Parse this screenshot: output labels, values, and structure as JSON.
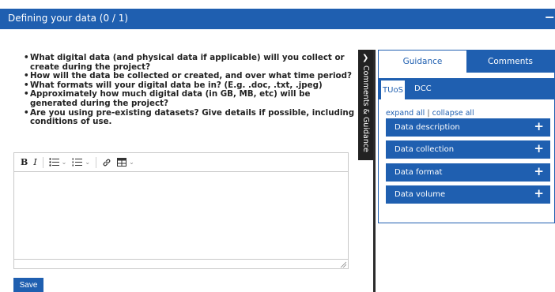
{
  "header": {
    "title": "Defining your data (0 / 1)",
    "toggle": "−"
  },
  "questions": [
    "What digital data (and physical data if applicable) will you collect or create during the project?",
    "How will the data be collected or created, and over what time period?",
    "What formats will your digital data be in? (E.g. .doc, .txt, .jpeg)",
    "Approximately how much digital data (in GB, MB, etc) will be generated during the project?",
    "Are you using pre-existing datasets? Give details if possible, including conditions of use."
  ],
  "editor": {
    "toolbar": {
      "bold": "B",
      "italic": "I",
      "bullet_list": "☰",
      "numbered_list": "☰",
      "link": "🔗",
      "table": "⊞",
      "caret": "⌄"
    },
    "content": ""
  },
  "save_label": "Save",
  "side_tab": {
    "arrow": "❯",
    "label": "Comments & Guidance"
  },
  "guidance_panel": {
    "tabs": [
      {
        "label": "Guidance"
      },
      {
        "label": "Comments"
      }
    ],
    "subtabs": [
      {
        "label": "TUoS"
      },
      {
        "label": "DCC"
      }
    ],
    "expand_all": "expand all",
    "separator": "|",
    "collapse_all": "collapse all",
    "sections": [
      {
        "label": "Data description",
        "icon": "+"
      },
      {
        "label": "Data collection",
        "icon": "+"
      },
      {
        "label": "Data format",
        "icon": "+"
      },
      {
        "label": "Data volume",
        "icon": "+"
      }
    ]
  },
  "colors": {
    "primary": "#1f5fb0",
    "side_tab": "#222222",
    "border": "#c9c9c9"
  }
}
